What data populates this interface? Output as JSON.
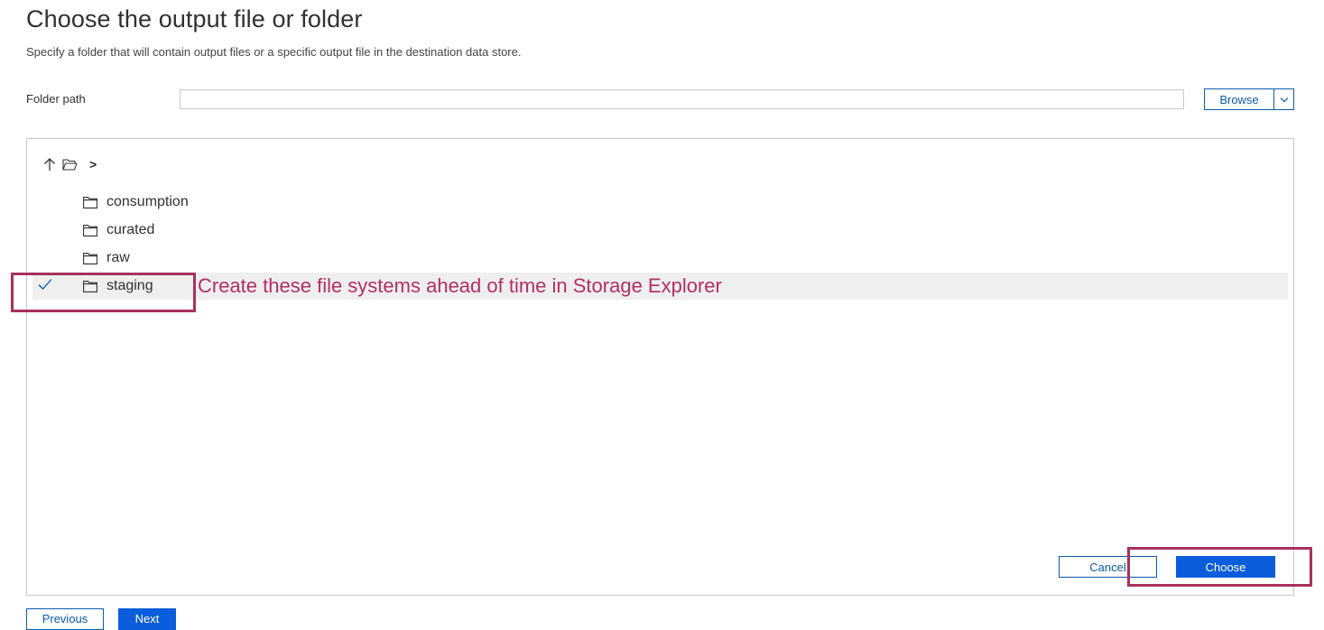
{
  "header": {
    "title": "Choose the output file or folder",
    "subtitle": "Specify a folder that will contain output files or a specific output file in the destination data store."
  },
  "folder_path": {
    "label": "Folder path",
    "value": "",
    "placeholder": ""
  },
  "browse": {
    "label": "Browse",
    "caret_icon": "chevron-down-icon"
  },
  "breadcrumb": {
    "up_icon": "arrow-up-icon",
    "folder_icon": "open-folder-icon",
    "separator": ">"
  },
  "folders": [
    {
      "name": "consumption",
      "icon": "folder-icon",
      "selected": false
    },
    {
      "name": "curated",
      "icon": "folder-icon",
      "selected": false
    },
    {
      "name": "raw",
      "icon": "folder-icon",
      "selected": false
    },
    {
      "name": "staging",
      "icon": "folder-icon",
      "selected": true
    }
  ],
  "annotation": {
    "text": "Create these file systems ahead of time in Storage Explorer",
    "color": "#b32f62"
  },
  "dialog_buttons": {
    "cancel_label": "Cancel",
    "choose_label": "Choose"
  },
  "footer_buttons": {
    "previous_label": "Previous",
    "next_label": "Next"
  },
  "colors": {
    "primary": "#0b5ddb",
    "accent_border": "#0b5cad",
    "selected_row": "#efefef",
    "highlight_box": "#a7325d"
  }
}
